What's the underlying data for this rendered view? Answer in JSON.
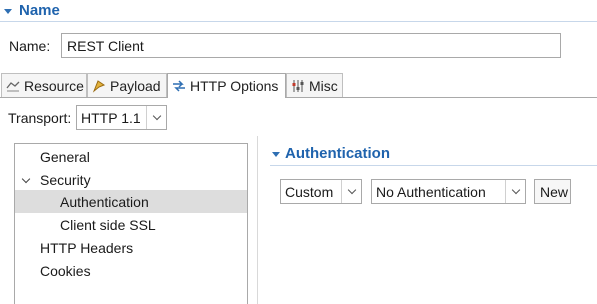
{
  "section": {
    "title": "Name"
  },
  "name": {
    "label": "Name:",
    "value": "REST Client"
  },
  "tabs": [
    {
      "label": "Resource",
      "icon": "resource-icon"
    },
    {
      "label": "Payload",
      "icon": "payload-icon"
    },
    {
      "label": "HTTP Options",
      "icon": "http-options-icon",
      "active": true
    },
    {
      "label": "Misc",
      "icon": "misc-icon"
    }
  ],
  "transport": {
    "label": "Transport:",
    "value": "HTTP 1.1"
  },
  "tree": {
    "items": [
      {
        "label": "General"
      },
      {
        "label": "Security",
        "expanded": true
      },
      {
        "label": "Authentication",
        "selected": true
      },
      {
        "label": "Client side SSL"
      },
      {
        "label": "HTTP Headers"
      },
      {
        "label": "Cookies"
      }
    ]
  },
  "auth": {
    "title": "Authentication",
    "mode": "Custom",
    "method": "No Authentication",
    "new_label": "New"
  },
  "colors": {
    "accent": "#1f63ad",
    "selection": "#dddddd"
  }
}
